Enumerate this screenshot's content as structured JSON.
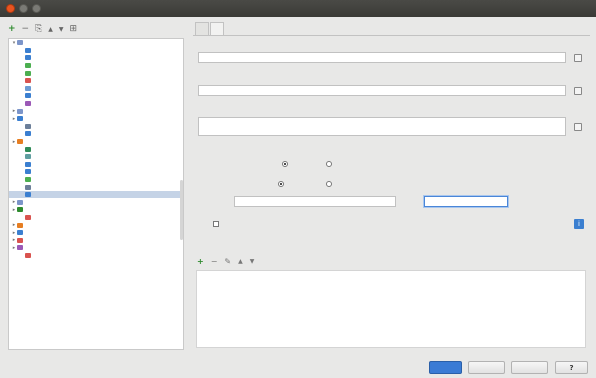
{
  "window": {
    "title": ""
  },
  "left_toolbar": {
    "add": "+",
    "remove": "−",
    "copy": "⎘",
    "move_up": "▲",
    "move_down": "▼",
    "sort": "⊞"
  },
  "tree": [
    {
      "label": "",
      "indent": 0,
      "arrow": "▾",
      "icon": "#7c95c9",
      "highlight": false,
      "selected": false
    },
    {
      "label": "",
      "indent": 1,
      "arrow": "",
      "icon": "#3b7fd0",
      "highlight": false,
      "selected": false
    },
    {
      "label": "",
      "indent": 1,
      "arrow": "",
      "icon": "#3b7fd0",
      "highlight": false,
      "selected": false
    },
    {
      "label": "",
      "indent": 1,
      "arrow": "",
      "icon": "#4caf50",
      "highlight": false,
      "selected": false
    },
    {
      "label": "",
      "indent": 1,
      "arrow": "",
      "icon": "#4caf50",
      "highlight": false,
      "selected": false
    },
    {
      "label": "",
      "indent": 1,
      "arrow": "",
      "icon": "#d9534f",
      "highlight": false,
      "selected": false
    },
    {
      "label": "",
      "indent": 1,
      "arrow": "",
      "icon": "#6c9bd2",
      "highlight": false,
      "selected": false
    },
    {
      "label": "",
      "indent": 1,
      "arrow": "",
      "icon": "#3b7fd0",
      "highlight": false,
      "selected": false
    },
    {
      "label": "",
      "indent": 1,
      "arrow": "",
      "icon": "#9b59b6",
      "highlight": false,
      "selected": false
    },
    {
      "label": "",
      "indent": 0,
      "arrow": "▸",
      "icon": "#7c95c9",
      "highlight": false,
      "selected": false
    },
    {
      "label": "",
      "indent": 0,
      "arrow": "▸",
      "icon": "#3b7fd0",
      "highlight": true,
      "selected": false
    },
    {
      "label": "",
      "indent": 1,
      "arrow": "",
      "icon": "#6c7f99",
      "highlight": false,
      "selected": false
    },
    {
      "label": "",
      "indent": 1,
      "arrow": "",
      "icon": "#3b7fd0",
      "highlight": false,
      "selected": false
    },
    {
      "label": "",
      "indent": 0,
      "arrow": "▸",
      "icon": "#e67e22",
      "highlight": false,
      "selected": false
    },
    {
      "label": "",
      "indent": 1,
      "arrow": "",
      "icon": "#2e8b57",
      "highlight": false,
      "selected": false
    },
    {
      "label": "",
      "indent": 1,
      "arrow": "",
      "icon": "#5f9ea0",
      "highlight": false,
      "selected": false
    },
    {
      "label": "",
      "indent": 1,
      "arrow": "",
      "icon": "#3b7fd0",
      "highlight": false,
      "selected": false
    },
    {
      "label": "",
      "indent": 1,
      "arrow": "",
      "icon": "#3b7fd0",
      "highlight": false,
      "selected": false
    },
    {
      "label": "",
      "indent": 1,
      "arrow": "",
      "icon": "#4caf50",
      "highlight": false,
      "selected": false
    },
    {
      "label": "",
      "indent": 1,
      "arrow": "",
      "icon": "#6c7f99",
      "highlight": false,
      "selected": false
    },
    {
      "label": "",
      "indent": 1,
      "arrow": "",
      "icon": "#3b7fd0",
      "highlight": false,
      "selected": true
    },
    {
      "label": "",
      "indent": 0,
      "arrow": "▸",
      "icon": "#7c95c9",
      "highlight": false,
      "selected": false
    },
    {
      "label": "",
      "indent": 0,
      "arrow": "▸",
      "icon": "#2e8b2e",
      "highlight": false,
      "selected": false
    },
    {
      "label": "",
      "indent": 1,
      "arrow": "",
      "icon": "#d9534f",
      "highlight": false,
      "selected": false
    },
    {
      "label": "",
      "indent": 0,
      "arrow": "▸",
      "icon": "#e67e22",
      "highlight": false,
      "selected": false
    },
    {
      "label": "",
      "indent": 0,
      "arrow": "▸",
      "icon": "#3b7fd0",
      "highlight": false,
      "selected": false
    },
    {
      "label": "",
      "indent": 0,
      "arrow": "▸",
      "icon": "#d9534f",
      "highlight": false,
      "selected": false
    },
    {
      "label": "",
      "indent": 0,
      "arrow": "▸",
      "icon": "#9b59b6",
      "highlight": false,
      "selected": false
    },
    {
      "label": "",
      "indent": 1,
      "arrow": "",
      "icon": "#d9534f",
      "highlight": false,
      "selected": false
    }
  ],
  "tabs": [
    {
      "label": "",
      "active": true
    },
    {
      "label": "",
      "active": false
    }
  ],
  "config": {
    "f1": {
      "label": "",
      "value": ""
    },
    "f2": {
      "label": "",
      "value": ""
    },
    "f3": {
      "label": "",
      "value": ""
    },
    "group": {
      "label": ""
    },
    "r1": {
      "label": "",
      "opt_a": "",
      "opt_b": ""
    },
    "r2": {
      "label": "",
      "opt_a": "",
      "opt_b": ""
    },
    "row": {
      "label_a": "",
      "value_a": "",
      "label_b": "",
      "value_b": ""
    },
    "checkbox_text": ""
  },
  "before_launch": {
    "label": "",
    "empty_text": "",
    "footer": ""
  },
  "buttons": {
    "primary": "",
    "cancel": "",
    "apply": "",
    "help": "?"
  },
  "colors": {
    "accent": "#3b7fd0",
    "selected_row": "#c5d3e6",
    "close_button": "#e95420"
  }
}
